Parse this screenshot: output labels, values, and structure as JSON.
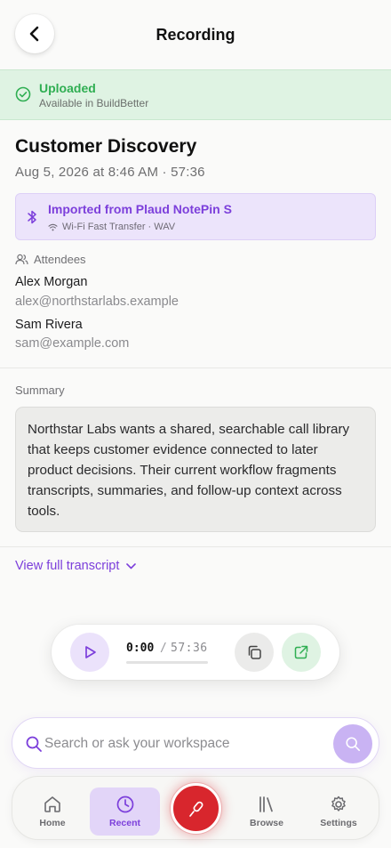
{
  "header": {
    "title": "Recording",
    "back_icon": "chevron-left-icon"
  },
  "banner": {
    "title": "Uploaded",
    "subtitle": "Available in BuildBetter",
    "icon": "check-circle-icon",
    "color": "#2fae52"
  },
  "recording": {
    "title": "Customer Discovery",
    "meta": "Aug 5, 2026 at 8:46 AM · 57:36"
  },
  "import_card": {
    "title": "Imported from Plaud NotePin S",
    "subtitle": "Wi-Fi Fast Transfer · WAV",
    "icon": "bluetooth-icon",
    "sub_icon": "wifi-icon",
    "accent": "#7c3fdb"
  },
  "attendees": {
    "label": "Attendees",
    "list": [
      {
        "name": "Alex Morgan",
        "email": "alex@northstarlabs.example"
      },
      {
        "name": "Sam Rivera",
        "email": "sam@example.com"
      }
    ]
  },
  "summary": {
    "label": "Summary",
    "text": "Northstar Labs wants a shared, searchable call library that keeps customer evidence connected to later product decisions. Their current workflow fragments transcripts, summaries, and follow-up context across tools."
  },
  "transcript_link": {
    "label": "View full transcript",
    "icon": "chevron-down-icon"
  },
  "player": {
    "current": "0:00",
    "separator": "/",
    "total": "57:36",
    "progress": 0,
    "play_icon": "play-icon",
    "copy_icon": "copy-icon",
    "share_icon": "external-link-icon"
  },
  "search": {
    "placeholder": "Search or ask your workspace",
    "value": ""
  },
  "tabs": [
    {
      "label": "Home",
      "icon": "home-icon"
    },
    {
      "label": "Recent",
      "icon": "clock-icon",
      "active": true
    },
    {
      "label": "Browse",
      "icon": "library-icon"
    },
    {
      "label": "Settings",
      "icon": "gear-icon"
    }
  ],
  "record_button": {
    "icon": "microphone-icon",
    "color": "#d8262d"
  }
}
